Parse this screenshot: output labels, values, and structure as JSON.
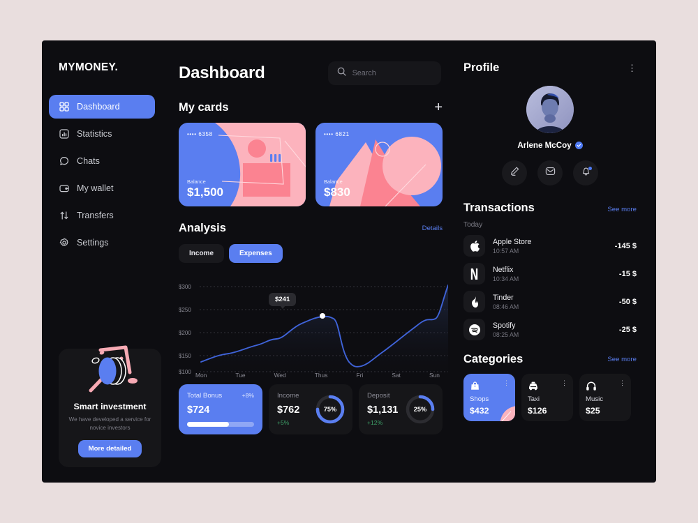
{
  "brand": {
    "logo": "MYMONEY."
  },
  "sidebar": {
    "items": [
      {
        "label": "Dashboard",
        "icon": "grid-icon",
        "active": true
      },
      {
        "label": "Statistics",
        "icon": "bar-chart-icon",
        "active": false
      },
      {
        "label": "Chats",
        "icon": "chat-bubble-icon",
        "active": false
      },
      {
        "label": "My wallet",
        "icon": "wallet-icon",
        "active": false
      },
      {
        "label": "Transfers",
        "icon": "transfer-arrows-icon",
        "active": false
      },
      {
        "label": "Settings",
        "icon": "gear-icon",
        "active": false
      }
    ],
    "promo": {
      "title": "Smart investment",
      "subtitle": "We have developed a service for novice investors",
      "button": "More detailed"
    }
  },
  "header": {
    "title": "Dashboard",
    "search_placeholder": "Search",
    "search_value": ""
  },
  "my_cards": {
    "title": "My cards",
    "add_label": "+",
    "cards": [
      {
        "number": "•••• 6358",
        "balance_label": "Balance",
        "balance": "$1,500",
        "theme": "blue-pink"
      },
      {
        "number": "•••• 6821",
        "balance_label": "Balance",
        "balance": "$830",
        "theme": "pink-blue"
      }
    ]
  },
  "analysis": {
    "title": "Analysis",
    "details_link": "Details",
    "tabs": [
      {
        "label": "Income",
        "active": false
      },
      {
        "label": "Expenses",
        "active": true
      }
    ],
    "tooltip": "$241"
  },
  "chart_data": {
    "type": "line",
    "title": "Analysis",
    "xlabel": "",
    "ylabel": "",
    "ylim": [
      100,
      300
    ],
    "yticks": [
      "$100",
      "$150",
      "$200",
      "$250",
      "$300"
    ],
    "categories": [
      "Mon",
      "Tue",
      "Wed",
      "Thus",
      "Fri",
      "Sat",
      "Sun"
    ],
    "grid": true,
    "legend": "none",
    "series": [
      {
        "name": "Expenses",
        "color": "#3f63d8",
        "values": [
          138,
          150,
          155,
          168,
          180,
          190,
          188,
          205,
          222,
          228,
          232,
          241,
          236,
          170,
          134,
          140,
          156,
          172,
          188,
          206,
          222,
          240,
          238,
          241,
          300
        ]
      }
    ],
    "highlight": {
      "label": "$241",
      "x_index": 11,
      "value": 241
    }
  },
  "stats": [
    {
      "label": "Total Bonus",
      "value": "$724",
      "delta": "+8%",
      "progress": 62,
      "kind": "progress",
      "accent": "#5a7ef0"
    },
    {
      "label": "Income",
      "value": "$762",
      "change": "+5%",
      "percent": "75%",
      "percent_num": 75,
      "kind": "donut"
    },
    {
      "label": "Deposit",
      "value": "$1,131",
      "change": "+12%",
      "percent": "25%",
      "percent_num": 25,
      "kind": "donut"
    }
  ],
  "profile": {
    "title": "Profile",
    "menu_icon": "more-vertical-icon",
    "name": "Arlene McCoy",
    "verified": true,
    "actions": [
      {
        "name": "edit-icon"
      },
      {
        "name": "mail-icon"
      },
      {
        "name": "bell-icon",
        "badge": true
      }
    ]
  },
  "transactions": {
    "title": "Transactions",
    "see_more": "See more",
    "group_label": "Today",
    "items": [
      {
        "name": "Apple Store",
        "time": "10:57 AM",
        "amount": "-145 $",
        "icon": "apple-icon"
      },
      {
        "name": "Netflix",
        "time": "10:34 AM",
        "amount": "-15 $",
        "icon": "netflix-icon"
      },
      {
        "name": "Tinder",
        "time": "08:46 AM",
        "amount": "-50 $",
        "icon": "tinder-flame-icon"
      },
      {
        "name": "Spotify",
        "time": "08:25 AM",
        "amount": "-25 $",
        "icon": "spotify-icon"
      }
    ]
  },
  "categories": {
    "title": "Categories",
    "see_more": "See more",
    "items": [
      {
        "name": "Shops",
        "value": "$432",
        "icon": "bag-icon",
        "active": true
      },
      {
        "name": "Taxi",
        "value": "$126",
        "icon": "taxi-icon",
        "active": false
      },
      {
        "name": "Music",
        "value": "$25",
        "icon": "headphones-icon",
        "active": false
      }
    ]
  },
  "colors": {
    "accent": "#5a7ef0",
    "pink": "#fb8391",
    "page_bg": "#e9dede",
    "panel_bg": "#0d0d11",
    "positive": "#3fa36a"
  }
}
